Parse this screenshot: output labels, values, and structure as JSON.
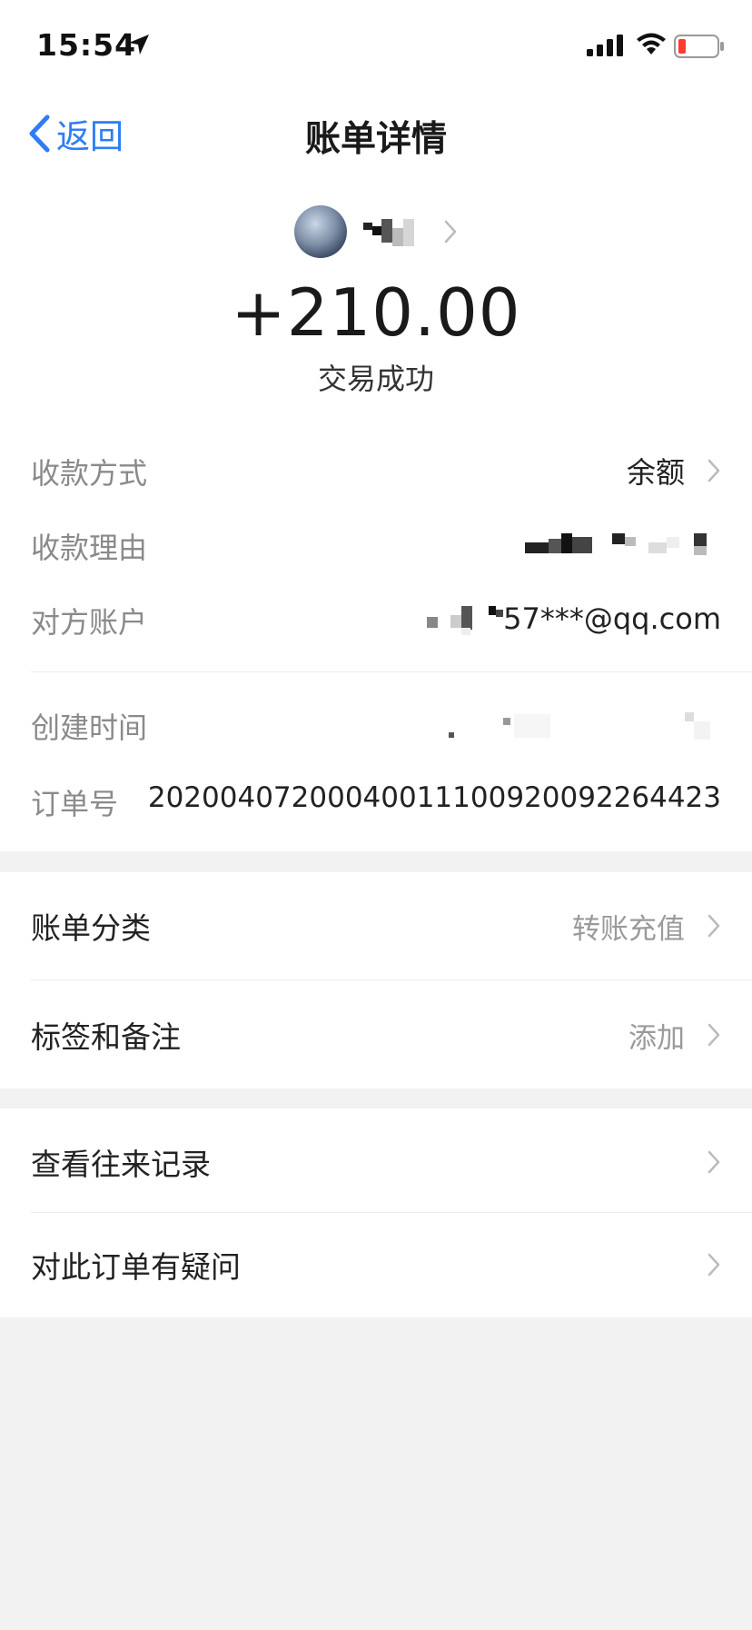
{
  "status_bar": {
    "time": "15:54"
  },
  "nav": {
    "back_label": "返回",
    "title": "账单详情"
  },
  "summary": {
    "amount": "+210.00",
    "status": "交易成功"
  },
  "details": [
    {
      "label": "收款方式",
      "value": "余额"
    },
    {
      "label": "收款理由",
      "value": ""
    },
    {
      "label": "对方账户",
      "value": "57***@qq.com"
    },
    {
      "label": "创建时间",
      "value": ""
    },
    {
      "label": "订单号",
      "value": "20200407200040011100920092264423"
    }
  ],
  "actions": [
    {
      "label": "账单分类",
      "value": "转账充值"
    },
    {
      "label": "标签和备注",
      "value": "添加"
    },
    {
      "label": "查看往来记录",
      "value": ""
    },
    {
      "label": "对此订单有疑问",
      "value": ""
    }
  ],
  "colors": {
    "accent": "#2f7cf6",
    "battery_low": "#ff3b30"
  }
}
